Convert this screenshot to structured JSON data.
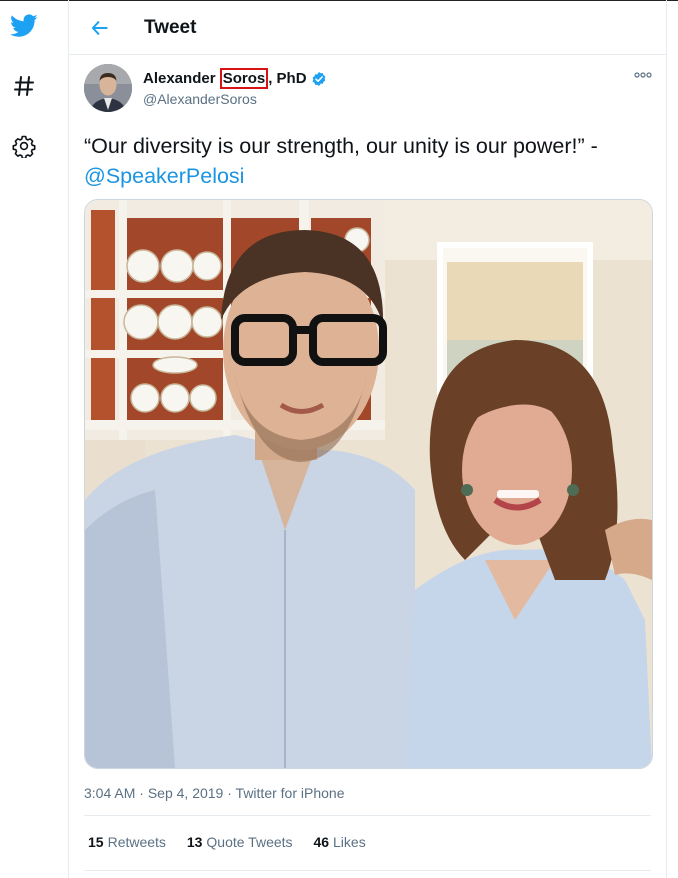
{
  "header": {
    "title": "Tweet"
  },
  "tweet": {
    "author_name_parts": [
      "Alexander ",
      "Soros",
      ", PhD"
    ],
    "handle": "@AlexanderSoros",
    "text_quote": "“Our diversity is our strength, our unity is our power!” -",
    "text_mention": "@SpeakerPelosi",
    "time": "3:04 AM",
    "date": "Sep 4, 2019",
    "source": "Twitter for iPhone",
    "separator": "·",
    "retweets_count": "15",
    "retweets_label": "Retweets",
    "quote_tweets_count": "13",
    "quote_tweets_label": "Quote Tweets",
    "likes_count": "46",
    "likes_label": "Likes"
  },
  "icons": {
    "sidebar": [
      "twitter-logo-icon",
      "hashtag-icon",
      "settings-gear-icon"
    ],
    "back": "arrow-left-icon",
    "more": "more-dots-icon",
    "verified": "verified-badge-icon"
  },
  "colors": {
    "accent": "#1da1f2",
    "mention": "#1b95e0",
    "highlight_box": "#d81313",
    "secondary_text": "#5b7083"
  }
}
